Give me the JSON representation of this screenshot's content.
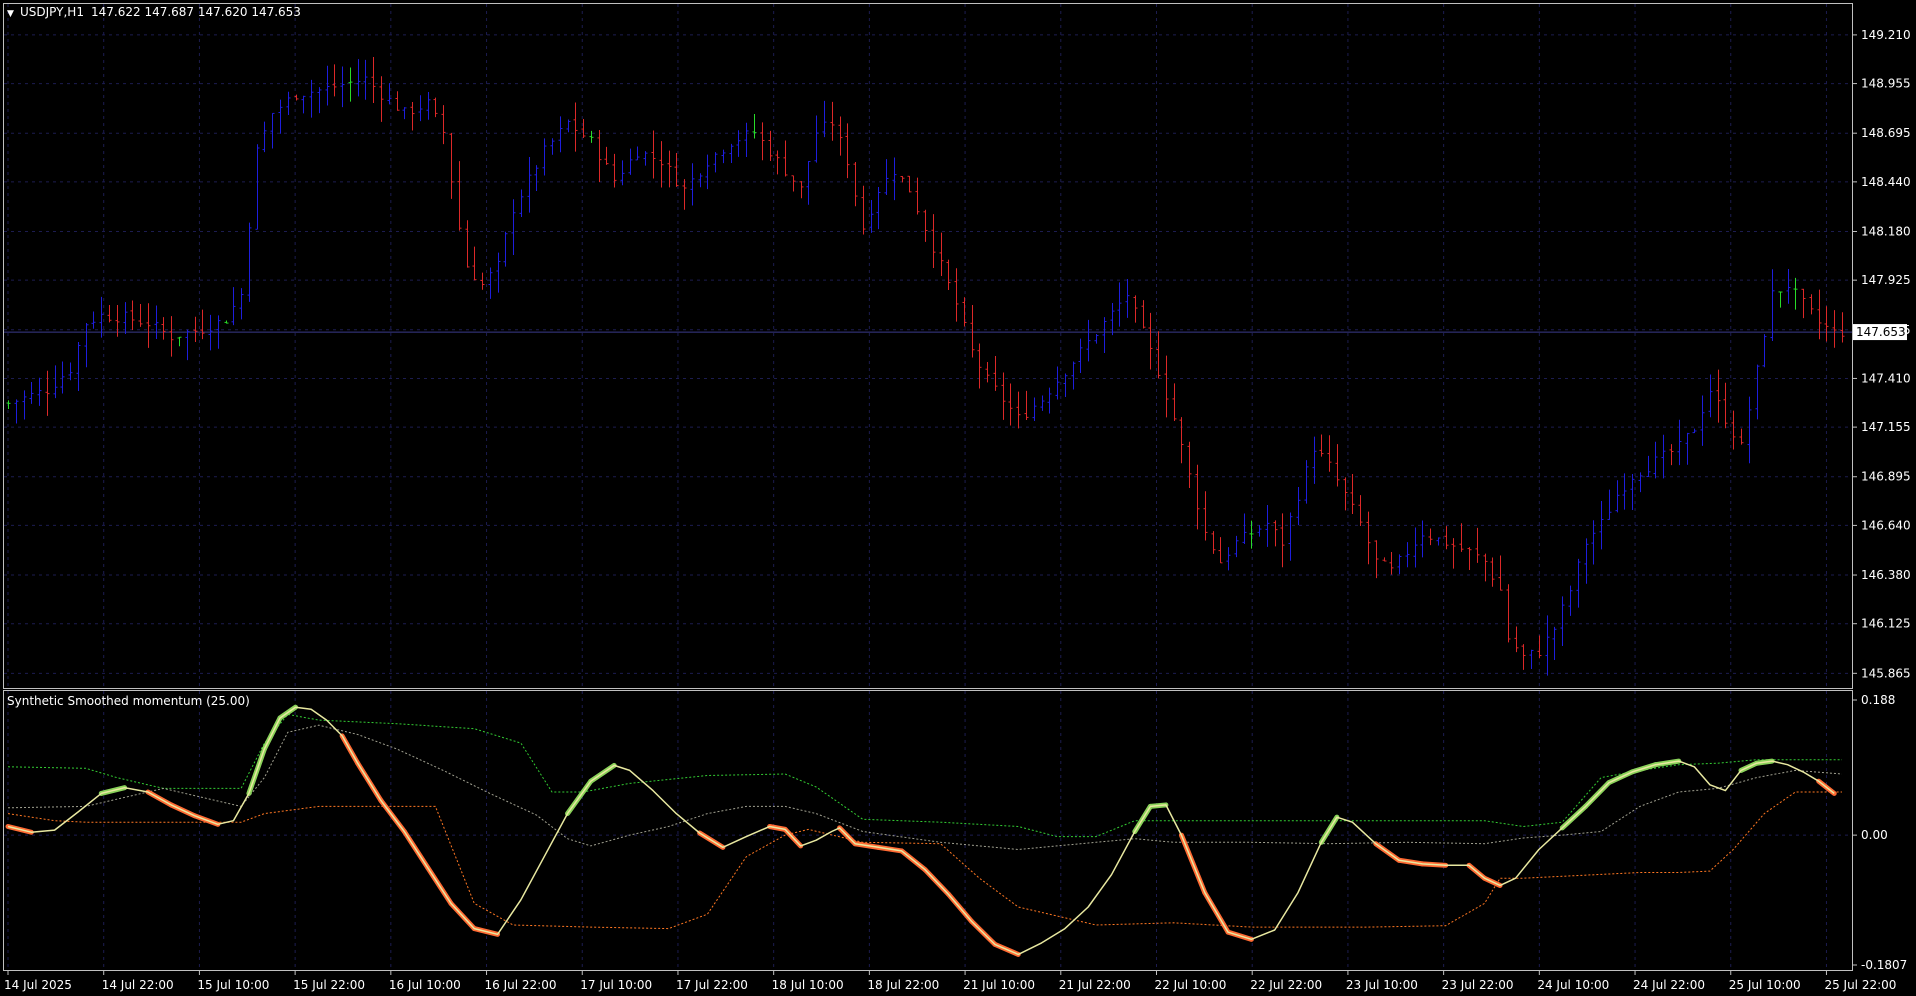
{
  "header": {
    "arrow": "▼",
    "symbol": "USDJPY,H1",
    "ohlc": "147.622 147.687 147.620 147.653"
  },
  "indicator": {
    "label": "Synthetic Smoothed momentum (25.00)"
  },
  "colors": {
    "background": "#000000",
    "frame": "#c0c0c0",
    "grid": "#1c1c50",
    "bull_candle": "#1e1edc",
    "bear_candle": "#dc2828",
    "doji_candle": "#28dc28",
    "main_line": "#e8e8a0",
    "up_line": "#8ad25a",
    "down_line": "#ff6a33",
    "upper_band": "#33cc33",
    "lower_band": "#ff7722",
    "mid_band": "#a0a090",
    "price_tag_bg": "#ffffff",
    "price_tag_text": "#000000"
  },
  "chart_data": [
    {
      "type": "candlestick",
      "title": "USDJPY,H1",
      "price_axis_ticks": [
        "149.210",
        "148.955",
        "148.695",
        "148.440",
        "148.180",
        "147.925",
        "147.665",
        "147.410",
        "147.155",
        "146.895",
        "146.640",
        "146.380",
        "146.125",
        "145.865"
      ],
      "current_price": "147.653",
      "ylim": [
        145.83,
        149.33
      ],
      "time_axis_ticks": [
        "14 Jul 2025",
        "14 Jul 22:00",
        "15 Jul 10:00",
        "15 Jul 22:00",
        "16 Jul 10:00",
        "16 Jul 22:00",
        "17 Jul 10:00",
        "17 Jul 22:00",
        "18 Jul 10:00",
        "18 Jul 22:00",
        "21 Jul 10:00",
        "21 Jul 22:00",
        "22 Jul 10:00",
        "22 Jul 22:00",
        "23 Jul 10:00",
        "23 Jul 22:00",
        "24 Jul 10:00",
        "24 Jul 22:00",
        "25 Jul 10:00",
        "25 Jul 22:00"
      ],
      "close_path": [
        [
          0,
          147.28
        ],
        [
          5,
          147.35
        ],
        [
          8,
          147.46
        ],
        [
          10,
          147.7
        ],
        [
          12,
          147.74
        ],
        [
          15,
          147.73
        ],
        [
          18,
          147.7
        ],
        [
          21,
          147.63
        ],
        [
          25,
          147.67
        ],
        [
          28,
          147.72
        ],
        [
          30,
          147.85
        ],
        [
          32,
          148.6
        ],
        [
          34,
          148.8
        ],
        [
          37,
          148.9
        ],
        [
          40,
          148.92
        ],
        [
          43,
          148.95
        ],
        [
          46,
          148.98
        ],
        [
          48,
          148.9
        ],
        [
          51,
          148.8
        ],
        [
          54,
          148.85
        ],
        [
          56,
          148.7
        ],
        [
          58,
          148.2
        ],
        [
          59,
          148.0
        ],
        [
          61,
          147.9
        ],
        [
          63,
          148.0
        ],
        [
          65,
          148.3
        ],
        [
          67,
          148.45
        ],
        [
          69,
          148.6
        ],
        [
          72,
          148.75
        ],
        [
          75,
          148.65
        ],
        [
          78,
          148.45
        ],
        [
          81,
          148.6
        ],
        [
          84,
          148.55
        ],
        [
          87,
          148.4
        ],
        [
          90,
          148.55
        ],
        [
          93,
          148.65
        ],
        [
          96,
          148.7
        ],
        [
          99,
          148.55
        ],
        [
          102,
          148.4
        ],
        [
          104,
          148.7
        ],
        [
          106,
          148.75
        ],
        [
          108,
          148.55
        ],
        [
          110,
          148.2
        ],
        [
          112,
          148.4
        ],
        [
          114,
          148.5
        ],
        [
          116,
          148.4
        ],
        [
          118,
          148.2
        ],
        [
          120,
          148.0
        ],
        [
          122,
          147.8
        ],
        [
          124,
          147.55
        ],
        [
          126,
          147.4
        ],
        [
          128,
          147.3
        ],
        [
          130,
          147.2
        ],
        [
          133,
          147.3
        ],
        [
          136,
          147.45
        ],
        [
          139,
          147.6
        ],
        [
          142,
          147.75
        ],
        [
          144,
          147.85
        ],
        [
          146,
          147.65
        ],
        [
          148,
          147.45
        ],
        [
          150,
          147.2
        ],
        [
          152,
          146.9
        ],
        [
          154,
          146.6
        ],
        [
          156,
          146.45
        ],
        [
          158,
          146.55
        ],
        [
          160,
          146.6
        ],
        [
          162,
          146.65
        ],
        [
          164,
          146.55
        ],
        [
          166,
          146.8
        ],
        [
          168,
          147.05
        ],
        [
          170,
          146.95
        ],
        [
          172,
          146.8
        ],
        [
          174,
          146.65
        ],
        [
          176,
          146.45
        ],
        [
          178,
          146.4
        ],
        [
          180,
          146.5
        ],
        [
          182,
          146.6
        ],
        [
          185,
          146.55
        ],
        [
          188,
          146.5
        ],
        [
          190,
          146.45
        ],
        [
          192,
          146.3
        ],
        [
          193,
          146.05
        ],
        [
          195,
          145.95
        ],
        [
          197,
          145.98
        ],
        [
          199,
          146.1
        ],
        [
          201,
          146.3
        ],
        [
          203,
          146.55
        ],
        [
          205,
          146.65
        ],
        [
          207,
          146.8
        ],
        [
          209,
          146.9
        ],
        [
          211,
          146.95
        ],
        [
          213,
          147.0
        ],
        [
          215,
          147.05
        ],
        [
          217,
          147.15
        ],
        [
          219,
          147.35
        ],
        [
          221,
          147.2
        ],
        [
          223,
          147.05
        ],
        [
          225,
          147.45
        ],
        [
          227,
          147.85
        ],
        [
          229,
          147.9
        ],
        [
          231,
          147.8
        ],
        [
          233,
          147.7
        ],
        [
          235,
          147.65
        ],
        [
          236,
          147.653
        ]
      ]
    },
    {
      "type": "line",
      "title": "Synthetic Smoothed momentum (25.00)",
      "ylim": [
        -0.1807,
        0.188
      ],
      "y_ticks": [
        "0.188",
        "0.00",
        "-0.1807"
      ],
      "momentum": [
        [
          0,
          0.012
        ],
        [
          3,
          0.004
        ],
        [
          6,
          0.007
        ],
        [
          9,
          0.032
        ],
        [
          12,
          0.058
        ],
        [
          15,
          0.066
        ],
        [
          18,
          0.06
        ],
        [
          21,
          0.042
        ],
        [
          24,
          0.027
        ],
        [
          27,
          0.015
        ],
        [
          29,
          0.02
        ],
        [
          31,
          0.058
        ],
        [
          33,
          0.12
        ],
        [
          35,
          0.163
        ],
        [
          37,
          0.178
        ],
        [
          39,
          0.175
        ],
        [
          41,
          0.16
        ],
        [
          43,
          0.138
        ],
        [
          45,
          0.1
        ],
        [
          48,
          0.048
        ],
        [
          51,
          0.005
        ],
        [
          54,
          -0.045
        ],
        [
          57,
          -0.095
        ],
        [
          60,
          -0.13
        ],
        [
          63,
          -0.138
        ],
        [
          66,
          -0.09
        ],
        [
          69,
          -0.03
        ],
        [
          72,
          0.03
        ],
        [
          75,
          0.075
        ],
        [
          78,
          0.097
        ],
        [
          80,
          0.09
        ],
        [
          83,
          0.062
        ],
        [
          86,
          0.03
        ],
        [
          89,
          0.003
        ],
        [
          92,
          -0.017
        ],
        [
          95,
          -0.002
        ],
        [
          98,
          0.012
        ],
        [
          100,
          0.008
        ],
        [
          102,
          -0.015
        ],
        [
          104,
          -0.007
        ],
        [
          106,
          0.005
        ],
        [
          107,
          0.01
        ],
        [
          109,
          -0.012
        ],
        [
          112,
          -0.017
        ],
        [
          115,
          -0.022
        ],
        [
          118,
          -0.048
        ],
        [
          121,
          -0.082
        ],
        [
          124,
          -0.12
        ],
        [
          127,
          -0.152
        ],
        [
          130,
          -0.166
        ],
        [
          133,
          -0.15
        ],
        [
          136,
          -0.13
        ],
        [
          139,
          -0.1
        ],
        [
          142,
          -0.055
        ],
        [
          145,
          0.005
        ],
        [
          147,
          0.04
        ],
        [
          149,
          0.042
        ],
        [
          151,
          0.0
        ],
        [
          154,
          -0.08
        ],
        [
          157,
          -0.135
        ],
        [
          160,
          -0.145
        ],
        [
          163,
          -0.132
        ],
        [
          166,
          -0.08
        ],
        [
          169,
          -0.01
        ],
        [
          171,
          0.025
        ],
        [
          173,
          0.018
        ],
        [
          176,
          -0.012
        ],
        [
          179,
          -0.035
        ],
        [
          182,
          -0.04
        ],
        [
          185,
          -0.042
        ],
        [
          188,
          -0.042
        ],
        [
          190,
          -0.06
        ],
        [
          192,
          -0.07
        ],
        [
          194,
          -0.06
        ],
        [
          197,
          -0.02
        ],
        [
          200,
          0.01
        ],
        [
          203,
          0.04
        ],
        [
          206,
          0.073
        ],
        [
          209,
          0.088
        ],
        [
          212,
          0.098
        ],
        [
          215,
          0.103
        ],
        [
          217,
          0.095
        ],
        [
          219,
          0.07
        ],
        [
          221,
          0.062
        ],
        [
          223,
          0.09
        ],
        [
          225,
          0.1
        ],
        [
          227,
          0.103
        ],
        [
          229,
          0.098
        ],
        [
          231,
          0.088
        ],
        [
          233,
          0.075
        ],
        [
          235,
          0.058
        ]
      ],
      "upper_band": [
        [
          0,
          0.095
        ],
        [
          10,
          0.093
        ],
        [
          14,
          0.08
        ],
        [
          20,
          0.065
        ],
        [
          30,
          0.065
        ],
        [
          33,
          0.128
        ],
        [
          36,
          0.168
        ],
        [
          40,
          0.16
        ],
        [
          50,
          0.155
        ],
        [
          60,
          0.148
        ],
        [
          66,
          0.128
        ],
        [
          70,
          0.06
        ],
        [
          74,
          0.06
        ],
        [
          80,
          0.072
        ],
        [
          90,
          0.083
        ],
        [
          100,
          0.085
        ],
        [
          104,
          0.067
        ],
        [
          110,
          0.022
        ],
        [
          120,
          0.018
        ],
        [
          130,
          0.012
        ],
        [
          135,
          -0.002
        ],
        [
          140,
          -0.002
        ],
        [
          145,
          0.02
        ],
        [
          150,
          0.02
        ],
        [
          190,
          0.02
        ],
        [
          195,
          0.012
        ],
        [
          200,
          0.018
        ],
        [
          205,
          0.08
        ],
        [
          210,
          0.09
        ],
        [
          215,
          0.098
        ],
        [
          220,
          0.1
        ],
        [
          225,
          0.105
        ],
        [
          236,
          0.105
        ]
      ],
      "mid_band": [
        [
          0,
          0.038
        ],
        [
          10,
          0.04
        ],
        [
          20,
          0.065
        ],
        [
          30,
          0.04
        ],
        [
          33,
          0.08
        ],
        [
          36,
          0.143
        ],
        [
          40,
          0.153
        ],
        [
          45,
          0.14
        ],
        [
          50,
          0.12
        ],
        [
          56,
          0.09
        ],
        [
          62,
          0.058
        ],
        [
          68,
          0.028
        ],
        [
          72,
          -0.005
        ],
        [
          75,
          -0.015
        ],
        [
          80,
          0.0
        ],
        [
          85,
          0.012
        ],
        [
          90,
          0.03
        ],
        [
          95,
          0.04
        ],
        [
          100,
          0.04
        ],
        [
          104,
          0.03
        ],
        [
          110,
          0.005
        ],
        [
          120,
          -0.01
        ],
        [
          130,
          -0.02
        ],
        [
          135,
          -0.015
        ],
        [
          140,
          -0.01
        ],
        [
          145,
          -0.005
        ],
        [
          150,
          -0.01
        ],
        [
          160,
          -0.01
        ],
        [
          170,
          -0.012
        ],
        [
          180,
          -0.01
        ],
        [
          190,
          -0.012
        ],
        [
          195,
          -0.004
        ],
        [
          200,
          0.0
        ],
        [
          205,
          0.005
        ],
        [
          210,
          0.04
        ],
        [
          215,
          0.06
        ],
        [
          220,
          0.065
        ],
        [
          225,
          0.08
        ],
        [
          230,
          0.09
        ],
        [
          236,
          0.085
        ]
      ],
      "lower_band": [
        [
          0,
          0.03
        ],
        [
          6,
          0.02
        ],
        [
          10,
          0.018
        ],
        [
          20,
          0.018
        ],
        [
          30,
          0.018
        ],
        [
          33,
          0.03
        ],
        [
          40,
          0.04
        ],
        [
          55,
          0.04
        ],
        [
          60,
          -0.095
        ],
        [
          65,
          -0.125
        ],
        [
          75,
          -0.128
        ],
        [
          85,
          -0.13
        ],
        [
          90,
          -0.11
        ],
        [
          95,
          -0.03
        ],
        [
          100,
          0.0
        ],
        [
          103,
          0.008
        ],
        [
          110,
          -0.01
        ],
        [
          120,
          -0.012
        ],
        [
          125,
          -0.06
        ],
        [
          130,
          -0.1
        ],
        [
          140,
          -0.125
        ],
        [
          150,
          -0.122
        ],
        [
          160,
          -0.128
        ],
        [
          175,
          -0.128
        ],
        [
          185,
          -0.126
        ],
        [
          190,
          -0.095
        ],
        [
          192,
          -0.06
        ],
        [
          195,
          -0.06
        ],
        [
          210,
          -0.052
        ],
        [
          215,
          -0.052
        ],
        [
          219,
          -0.05
        ],
        [
          222,
          -0.02
        ],
        [
          226,
          0.03
        ],
        [
          230,
          0.06
        ],
        [
          236,
          0.06
        ]
      ]
    }
  ]
}
